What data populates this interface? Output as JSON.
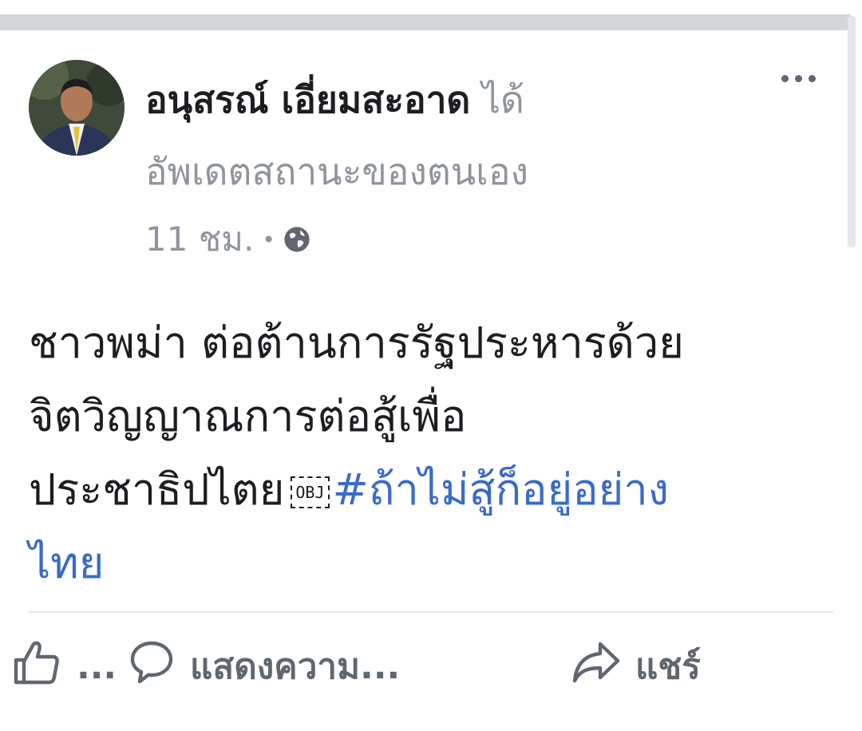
{
  "post": {
    "author_name": "อนุสรณ์ เอี่ยมสะอาด",
    "action_text": "ได้",
    "action_text_line2": "อัพเดตสถานะของตนเอง",
    "timestamp": "11 ชม.",
    "separator": "•",
    "privacy_icon": "globe-icon",
    "body_lines": [
      "ชาวพม่า ต่อต้านการรัฐประหารด้วย",
      "จิตวิญญาณการต่อสู้เพื่อ",
      "ประชาธิปไตย"
    ],
    "obj_placeholder": "OBJ",
    "hashtag_part1": "#ถ้าไม่สู้ก็อยู่อย่าง",
    "hashtag_part2": "ไทย"
  },
  "actions": {
    "like_label": "...",
    "comment_label": "แสดงความ...",
    "share_label": "แชร์"
  },
  "colors": {
    "text": "#1c1e21",
    "secondary": "#90949c",
    "icon": "#606770",
    "hashtag": "#3b6bc8",
    "divider": "#e4e6ea"
  }
}
